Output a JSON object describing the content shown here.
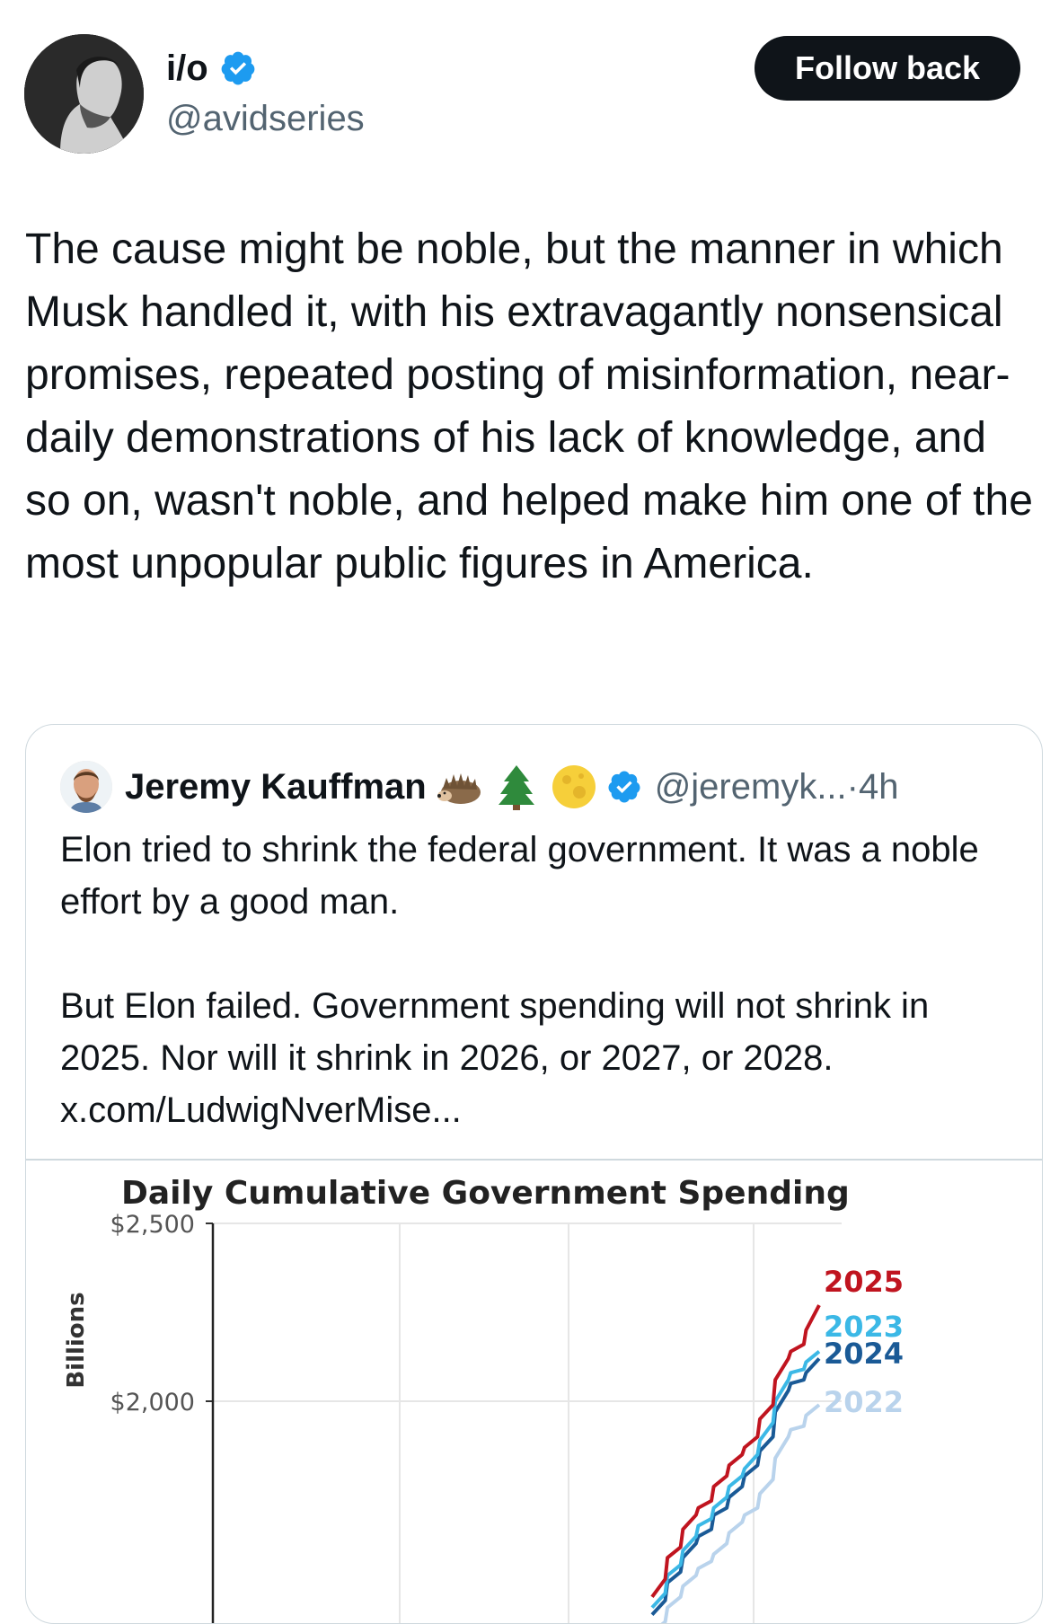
{
  "author": {
    "display_name": "i/o",
    "handle": "@avidseries",
    "follow_label": "Follow back"
  },
  "tweet": {
    "text": "The cause might be noble, but the manner in which Musk handled it, with his extravagantly nonsensical promises, repeated posting of misinformation, near-daily demonstrations of his lack of knowledge, and so on, wasn't noble, and helped make him one of the most unpopular public figures in America."
  },
  "quote": {
    "display_name": "Jeremy Kauffman",
    "handle": "@jeremyk...",
    "separator": " · ",
    "time": "4h",
    "emojis": [
      "hedgehog-icon",
      "evergreen-tree-icon",
      "full-moon-icon"
    ],
    "paragraph_1": "Elon tried to shrink the federal government. It was a noble effort by a good man.",
    "paragraph_2": "But Elon failed. Government spending will not shrink in 2025. Nor will it shrink in 2026, or 2027, or 2028.",
    "link": "x.com/LudwigNverMise..."
  },
  "colors": {
    "verified": "#1d9bf0",
    "s2025": "#c0141f",
    "s2023": "#3bb8e6",
    "s2024": "#1a5a96",
    "s2022": "#b9d3ec"
  },
  "chart_data": {
    "type": "line",
    "title": "Daily Cumulative Government Spending",
    "ylabel": "Billions",
    "yticks": [
      "$2,500",
      "$2,000"
    ],
    "ylim_visible": [
      1550,
      2500
    ],
    "grid": true,
    "legend": "inline-right",
    "series": [
      {
        "name": "2025",
        "color": "#c0141f",
        "values": [
          1450,
          1500,
          1560,
          1590,
          1640,
          1680,
          1700,
          1720,
          1760,
          1790,
          1820,
          1850,
          1870,
          1900,
          1950,
          1990,
          2060,
          2120,
          2140,
          2160,
          2200,
          2270
        ]
      },
      {
        "name": "2023",
        "color": "#3bb8e6",
        "values": [
          1420,
          1460,
          1510,
          1540,
          1580,
          1620,
          1650,
          1670,
          1700,
          1730,
          1760,
          1790,
          1810,
          1850,
          1890,
          1940,
          2000,
          2060,
          2080,
          2090,
          2110,
          2140
        ]
      },
      {
        "name": "2024",
        "color": "#1a5a96",
        "values": [
          1400,
          1440,
          1490,
          1520,
          1560,
          1600,
          1620,
          1640,
          1680,
          1700,
          1730,
          1760,
          1790,
          1820,
          1860,
          1900,
          1970,
          2030,
          2050,
          2060,
          2080,
          2120
        ]
      },
      {
        "name": "2022",
        "color": "#b9d3ec",
        "values": [
          1350,
          1380,
          1420,
          1450,
          1480,
          1510,
          1530,
          1550,
          1570,
          1600,
          1630,
          1660,
          1680,
          1700,
          1740,
          1780,
          1840,
          1900,
          1920,
          1930,
          1960,
          1990
        ]
      }
    ]
  }
}
